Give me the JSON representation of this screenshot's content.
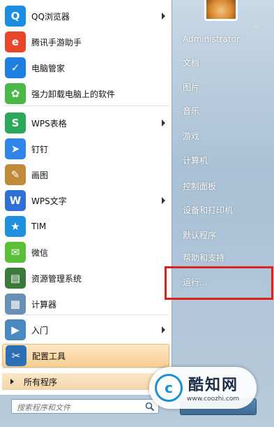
{
  "left_items": [
    {
      "label": "QQ浏览器",
      "icon": "qq-browser-icon",
      "has_arrow": true,
      "color": "#1c8de0"
    },
    {
      "label": "腾讯手游助手",
      "icon": "tencent-game-assistant-icon",
      "has_arrow": false,
      "color": "#e8452b"
    },
    {
      "label": "电脑管家",
      "icon": "pc-manager-shield-icon",
      "has_arrow": false,
      "color": "#1e7fe0"
    },
    {
      "label": "强力卸载电脑上的软件",
      "icon": "uninstall-flower-icon",
      "has_arrow": false,
      "color": "#4ab846"
    },
    {
      "label": "WPS表格",
      "icon": "wps-spreadsheet-icon",
      "has_arrow": true,
      "color": "#2aa95a"
    },
    {
      "label": "钉钉",
      "icon": "dingtalk-icon",
      "has_arrow": false,
      "color": "#2f86e8"
    },
    {
      "label": "画图",
      "icon": "paint-palette-icon",
      "has_arrow": false,
      "color": "#c08a3a"
    },
    {
      "label": "WPS文字",
      "icon": "wps-writer-icon",
      "has_arrow": true,
      "color": "#2f6fd6"
    },
    {
      "label": "TIM",
      "icon": "tim-star-icon",
      "has_arrow": false,
      "color": "#1f8fe0"
    },
    {
      "label": "微信",
      "icon": "wechat-icon",
      "has_arrow": false,
      "color": "#5bbf3a"
    },
    {
      "label": "资源管理系统",
      "icon": "resource-manager-icon",
      "has_arrow": false,
      "color": "#3b7a3b"
    },
    {
      "label": "计算器",
      "icon": "calculator-icon",
      "has_arrow": false,
      "color": "#6a8fb5"
    },
    {
      "label": "入门",
      "icon": "getting-started-icon",
      "has_arrow": true,
      "color": "#4a8ac0"
    },
    {
      "label": "配置工具",
      "icon": "config-wrench-icon",
      "has_arrow": false,
      "color": "#2d6fb5",
      "selected": true
    }
  ],
  "all_programs_label": "所有程序",
  "search_placeholder": "搜索程序和文件",
  "right_items": [
    "Administrator",
    "文档",
    "图片",
    "音乐",
    "游戏",
    "计算机",
    "控制面板",
    "设备和打印机",
    "默认程序",
    "帮助和支持",
    "运行..."
  ],
  "watermark": {
    "char": "c",
    "title": "酷知网",
    "url": "www.coozhi.com"
  },
  "highlight_color": "#d9231f"
}
